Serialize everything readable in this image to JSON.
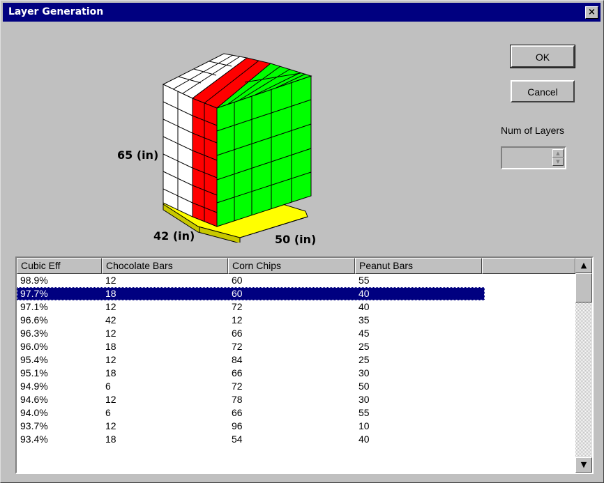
{
  "window": {
    "title": "Layer Generation",
    "close_label": "×"
  },
  "buttons": {
    "ok": "OK",
    "cancel": "Cancel"
  },
  "layers": {
    "label": "Num of Layers",
    "value": ""
  },
  "pallet": {
    "height_label": "65 (in)",
    "depth_label": "42 (in)",
    "width_label": "50 (in)",
    "colors": {
      "box_white": "#ffffff",
      "box_red": "#ff0000",
      "box_green": "#00ff00",
      "pallet": "#ffff00"
    }
  },
  "table": {
    "columns": [
      "Cubic Eff",
      "Chocolate Bars",
      "Corn Chips",
      "Peanut Bars"
    ],
    "selected_index": 1,
    "rows": [
      [
        "98.9%",
        "12",
        "60",
        "55"
      ],
      [
        "97.7%",
        "18",
        "60",
        "40"
      ],
      [
        "97.1%",
        "12",
        "72",
        "40"
      ],
      [
        "96.6%",
        "42",
        "12",
        "35"
      ],
      [
        "96.3%",
        "12",
        "66",
        "45"
      ],
      [
        "96.0%",
        "18",
        "72",
        "25"
      ],
      [
        "95.4%",
        "12",
        "84",
        "25"
      ],
      [
        "95.1%",
        "18",
        "66",
        "30"
      ],
      [
        "94.9%",
        "6",
        "72",
        "50"
      ],
      [
        "94.6%",
        "12",
        "78",
        "30"
      ],
      [
        "94.0%",
        "6",
        "66",
        "55"
      ],
      [
        "93.7%",
        "12",
        "96",
        "10"
      ],
      [
        "93.4%",
        "18",
        "54",
        "40"
      ]
    ]
  },
  "colors": {
    "title_bar": "#000080",
    "face": "#c0c0c0",
    "selection": "#000080"
  }
}
